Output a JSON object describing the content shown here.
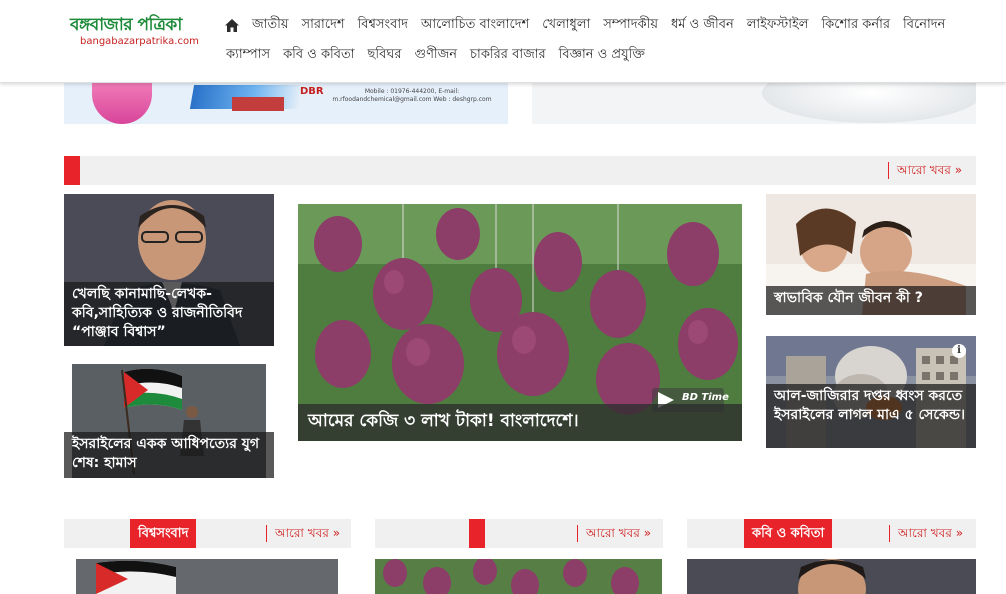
{
  "header": {
    "logo_title": "বঙ্গবাজার পত্রিকা",
    "logo_url": "bangabazarpatrika.com",
    "nav_row_1": [
      "জাতীয়",
      "সারাদেশ",
      "বিশ্বসংবাদ",
      "আলোচিত বাংলাদেশ",
      "খেলাধুলা",
      "সম্পাদকীয়",
      "ধর্ম ও জীবন",
      "লাইফস্টাইল",
      "কিশোর কর্নার",
      "বিনোদন"
    ],
    "nav_row_2": [
      "ক্যাম্পাস",
      "কবি ও কবিতা",
      "ছবিঘর",
      "গুণীজন",
      "চাকরির বাজার",
      "বিজ্ঞান ও প্রযুক্তি"
    ],
    "home_icon": "home-icon"
  },
  "banner_left": {
    "brand": "DBR",
    "contact": "Mobile : 01976-444200, E-mail: m.rfoodandchemical@gmail.com Web : deshgrp.com"
  },
  "featured": {
    "more_label": "আরো খবর »",
    "left_1": "খেলছি কানামাছি-লেখক-কবি,সাহিত্যিক ও রাজনীতিবিদ “পাঞ্জাব বিশ্বাস”",
    "left_2": "ইসরাইলের একক আধিপত্যের যুগ শেষ: হামাস",
    "main": "আমের কেজি ৩ লাখ টাকা! বাংলাদেশে।",
    "main_watermark": "BD Time",
    "right_1": "স্বাভাবিক যৌন জীবন কী ?",
    "right_2": "আল-জাজিরার দপ্তর ধ্বংস করতে ইসরাইলের লাগল মাএ ৫ সেকেন্ড।",
    "info_icon": "info-icon"
  },
  "sections": [
    {
      "title": "বিশ্বসংবাদ",
      "more_label": "আরো খবর »"
    },
    {
      "title": "",
      "more_label": "আরো খবর »"
    },
    {
      "title": "কবি ও কবিতা",
      "more_label": "আরো খবর »"
    }
  ],
  "colors": {
    "accent_red": "#e8232a",
    "logo_green": "#1d8a3a",
    "bar_gray": "#f0f0f0"
  }
}
